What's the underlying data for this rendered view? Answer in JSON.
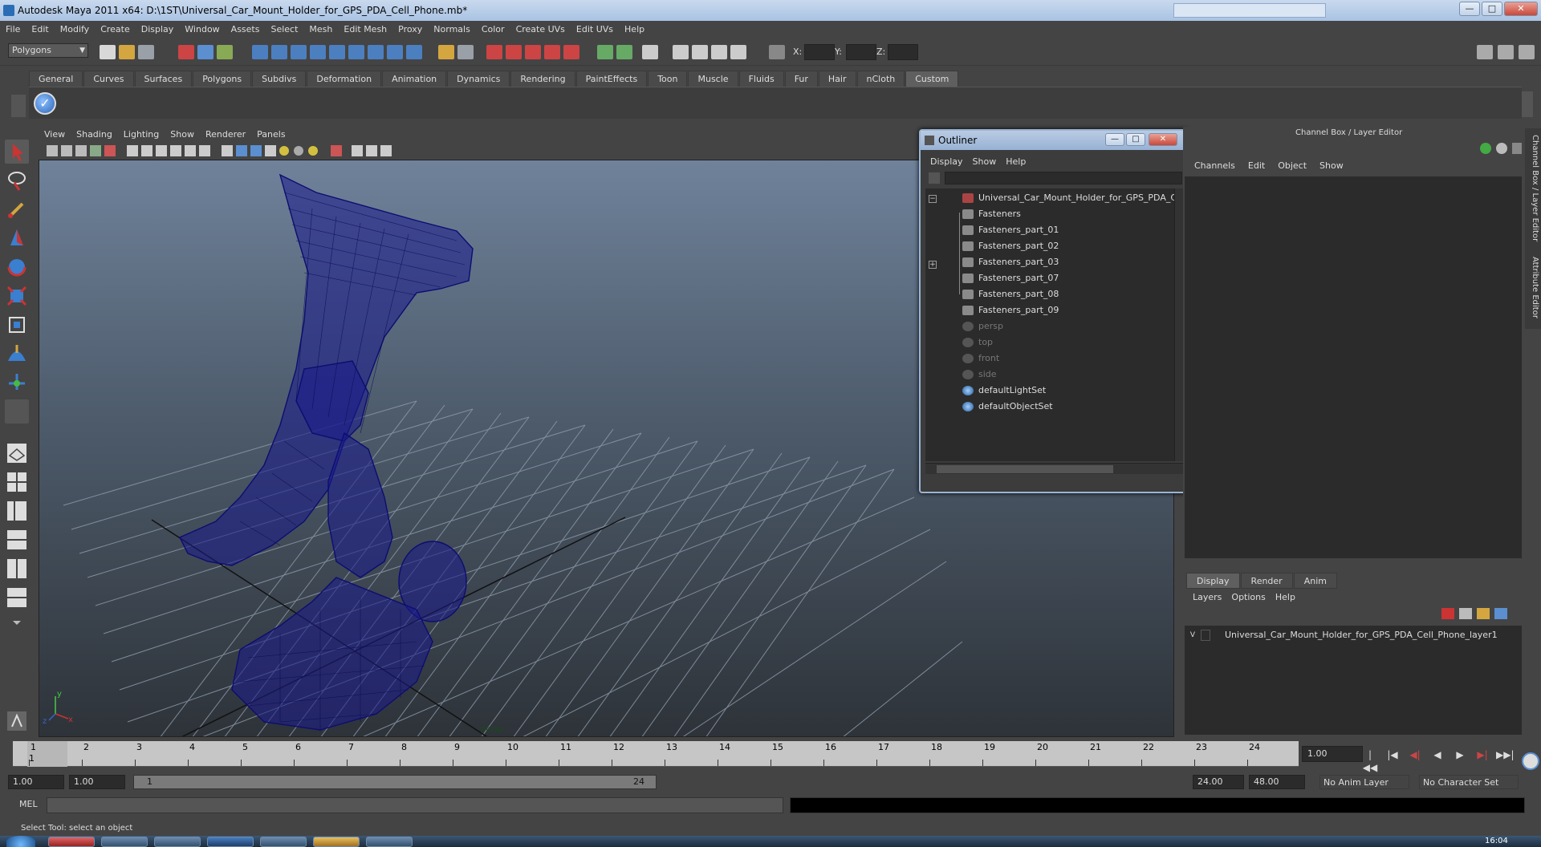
{
  "window": {
    "title": "Autodesk Maya 2011 x64: D:\\1ST\\Universal_Car_Mount_Holder_for_GPS_PDA_Cell_Phone.mb*",
    "minimize": "—",
    "maximize": "□",
    "close": "✕"
  },
  "menubar": [
    "File",
    "Edit",
    "Modify",
    "Create",
    "Display",
    "Window",
    "Assets",
    "Select",
    "Mesh",
    "Edit Mesh",
    "Proxy",
    "Normals",
    "Color",
    "Create UVs",
    "Edit UVs",
    "Help"
  ],
  "statusline": {
    "mode": "Polygons",
    "x_label": "X:",
    "y_label": "Y:",
    "z_label": "Z:"
  },
  "shelf": {
    "tabs": [
      "General",
      "Curves",
      "Surfaces",
      "Polygons",
      "Subdivs",
      "Deformation",
      "Animation",
      "Dynamics",
      "Rendering",
      "PaintEffects",
      "Toon",
      "Muscle",
      "Fluids",
      "Fur",
      "Hair",
      "nCloth",
      "Custom"
    ],
    "active_tab": "Custom"
  },
  "viewport": {
    "menu": [
      "View",
      "Shading",
      "Lighting",
      "Show",
      "Renderer",
      "Panels"
    ],
    "camera_label": "persp",
    "axis_x": "x",
    "axis_y": "y",
    "axis_z": "z",
    "colors": {
      "wireframe": "#1a1a8c",
      "grid": "#8b99a8",
      "grid_axis": "#111111"
    }
  },
  "outliner": {
    "title": "Outliner",
    "menu": [
      "Display",
      "Show",
      "Help"
    ],
    "nodes": [
      {
        "label": "Universal_Car_Mount_Holder_for_GPS_PDA_Cel",
        "icon": "group-icon"
      },
      {
        "label": "Fasteners",
        "icon": "mesh-icon"
      },
      {
        "label": "Fasteners_part_01",
        "icon": "mesh-icon"
      },
      {
        "label": "Fasteners_part_02",
        "icon": "mesh-icon"
      },
      {
        "label": "Fasteners_part_03",
        "icon": "mesh-icon"
      },
      {
        "label": "Fasteners_part_07",
        "icon": "mesh-icon"
      },
      {
        "label": "Fasteners_part_08",
        "icon": "mesh-icon"
      },
      {
        "label": "Fasteners_part_09",
        "icon": "mesh-icon"
      },
      {
        "label": "persp",
        "icon": "camera-icon"
      },
      {
        "label": "top",
        "icon": "camera-icon"
      },
      {
        "label": "front",
        "icon": "camera-icon"
      },
      {
        "label": "side",
        "icon": "camera-icon"
      },
      {
        "label": "defaultLightSet",
        "icon": "set-icon"
      },
      {
        "label": "defaultObjectSet",
        "icon": "set-icon"
      }
    ]
  },
  "channel_box": {
    "title": "Channel Box / Layer Editor",
    "menu": [
      "Channels",
      "Edit",
      "Object",
      "Show"
    ],
    "side_tabs": [
      "Channel Box / Layer Editor",
      "Attribute Editor"
    ]
  },
  "layer_editor": {
    "tabs": [
      "Display",
      "Render",
      "Anim"
    ],
    "active_tab": "Display",
    "menu": [
      "Layers",
      "Options",
      "Help"
    ],
    "layer_visibility": "V",
    "layer_name": "Universal_Car_Mount_Holder_for_GPS_PDA_Cell_Phone_layer1"
  },
  "timeline": {
    "ticks": [
      "1",
      "2",
      "3",
      "4",
      "5",
      "6",
      "7",
      "8",
      "9",
      "10",
      "11",
      "12",
      "13",
      "14",
      "15",
      "16",
      "17",
      "18",
      "19",
      "20",
      "21",
      "22",
      "23",
      "24"
    ],
    "current_frame_label": "1",
    "current_frame_field": "1.00"
  },
  "playback": {
    "go_start": "|◀◀",
    "step_back_key": "|◀",
    "step_back": "◀|",
    "play_back": "◀",
    "play_fwd": "▶",
    "step_fwd": "▶|",
    "go_end": "▶▶|"
  },
  "range": {
    "start_time": "1.00",
    "playback_start": "1.00",
    "slider_start": "1",
    "slider_end": "24",
    "playback_end": "24.00",
    "end_time": "48.00",
    "anim_layer": "No Anim Layer",
    "character_set": "No Character Set"
  },
  "command_line": {
    "label": "MEL"
  },
  "help_line": "Select Tool: select an object",
  "taskbar": {
    "clock": "16:04"
  }
}
